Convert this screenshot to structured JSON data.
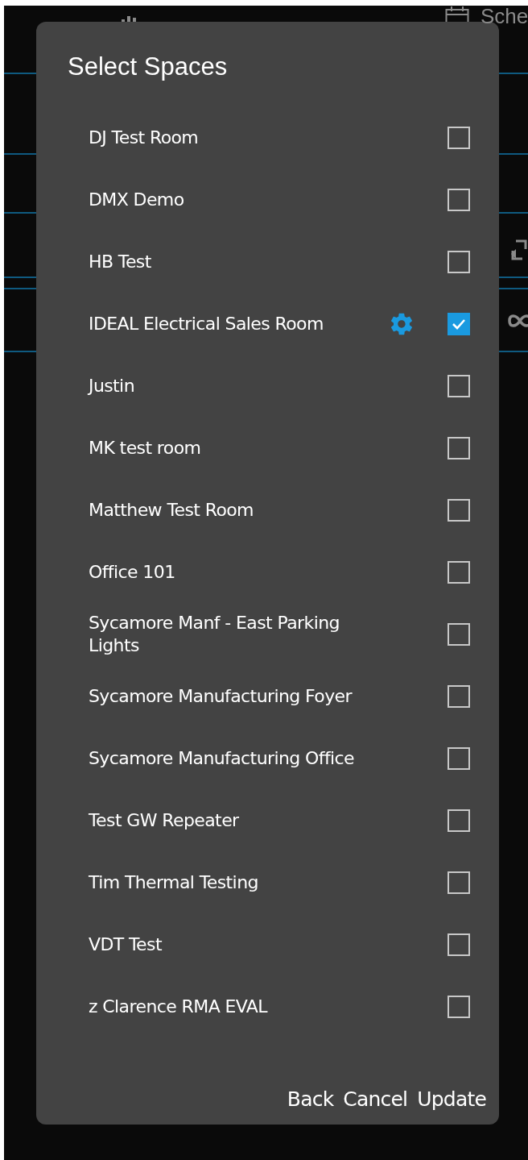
{
  "background": {
    "tabs": [
      {
        "label": "Sche"
      }
    ]
  },
  "dialog": {
    "title": "Select Spaces",
    "spaces": [
      {
        "name": "DJ Test Room",
        "checked": false,
        "settings": false
      },
      {
        "name": "DMX Demo",
        "checked": false,
        "settings": false
      },
      {
        "name": "HB Test",
        "checked": false,
        "settings": false
      },
      {
        "name": "IDEAL Electrical Sales Room",
        "checked": true,
        "settings": true
      },
      {
        "name": "Justin",
        "checked": false,
        "settings": false
      },
      {
        "name": "MK test room",
        "checked": false,
        "settings": false
      },
      {
        "name": "Matthew Test Room",
        "checked": false,
        "settings": false
      },
      {
        "name": "Office 101",
        "checked": false,
        "settings": false
      },
      {
        "name": "Sycamore Manf - East Parking Lights",
        "checked": false,
        "settings": false
      },
      {
        "name": "Sycamore Manufacturing Foyer",
        "checked": false,
        "settings": false
      },
      {
        "name": "Sycamore Manufacturing Office",
        "checked": false,
        "settings": false
      },
      {
        "name": "Test GW Repeater",
        "checked": false,
        "settings": false
      },
      {
        "name": "Tim Thermal Testing",
        "checked": false,
        "settings": false
      },
      {
        "name": "VDT Test",
        "checked": false,
        "settings": false
      },
      {
        "name": "z Clarence RMA EVAL",
        "checked": false,
        "settings": false
      }
    ],
    "buttons": [
      "Back",
      "Cancel",
      "Update"
    ]
  }
}
